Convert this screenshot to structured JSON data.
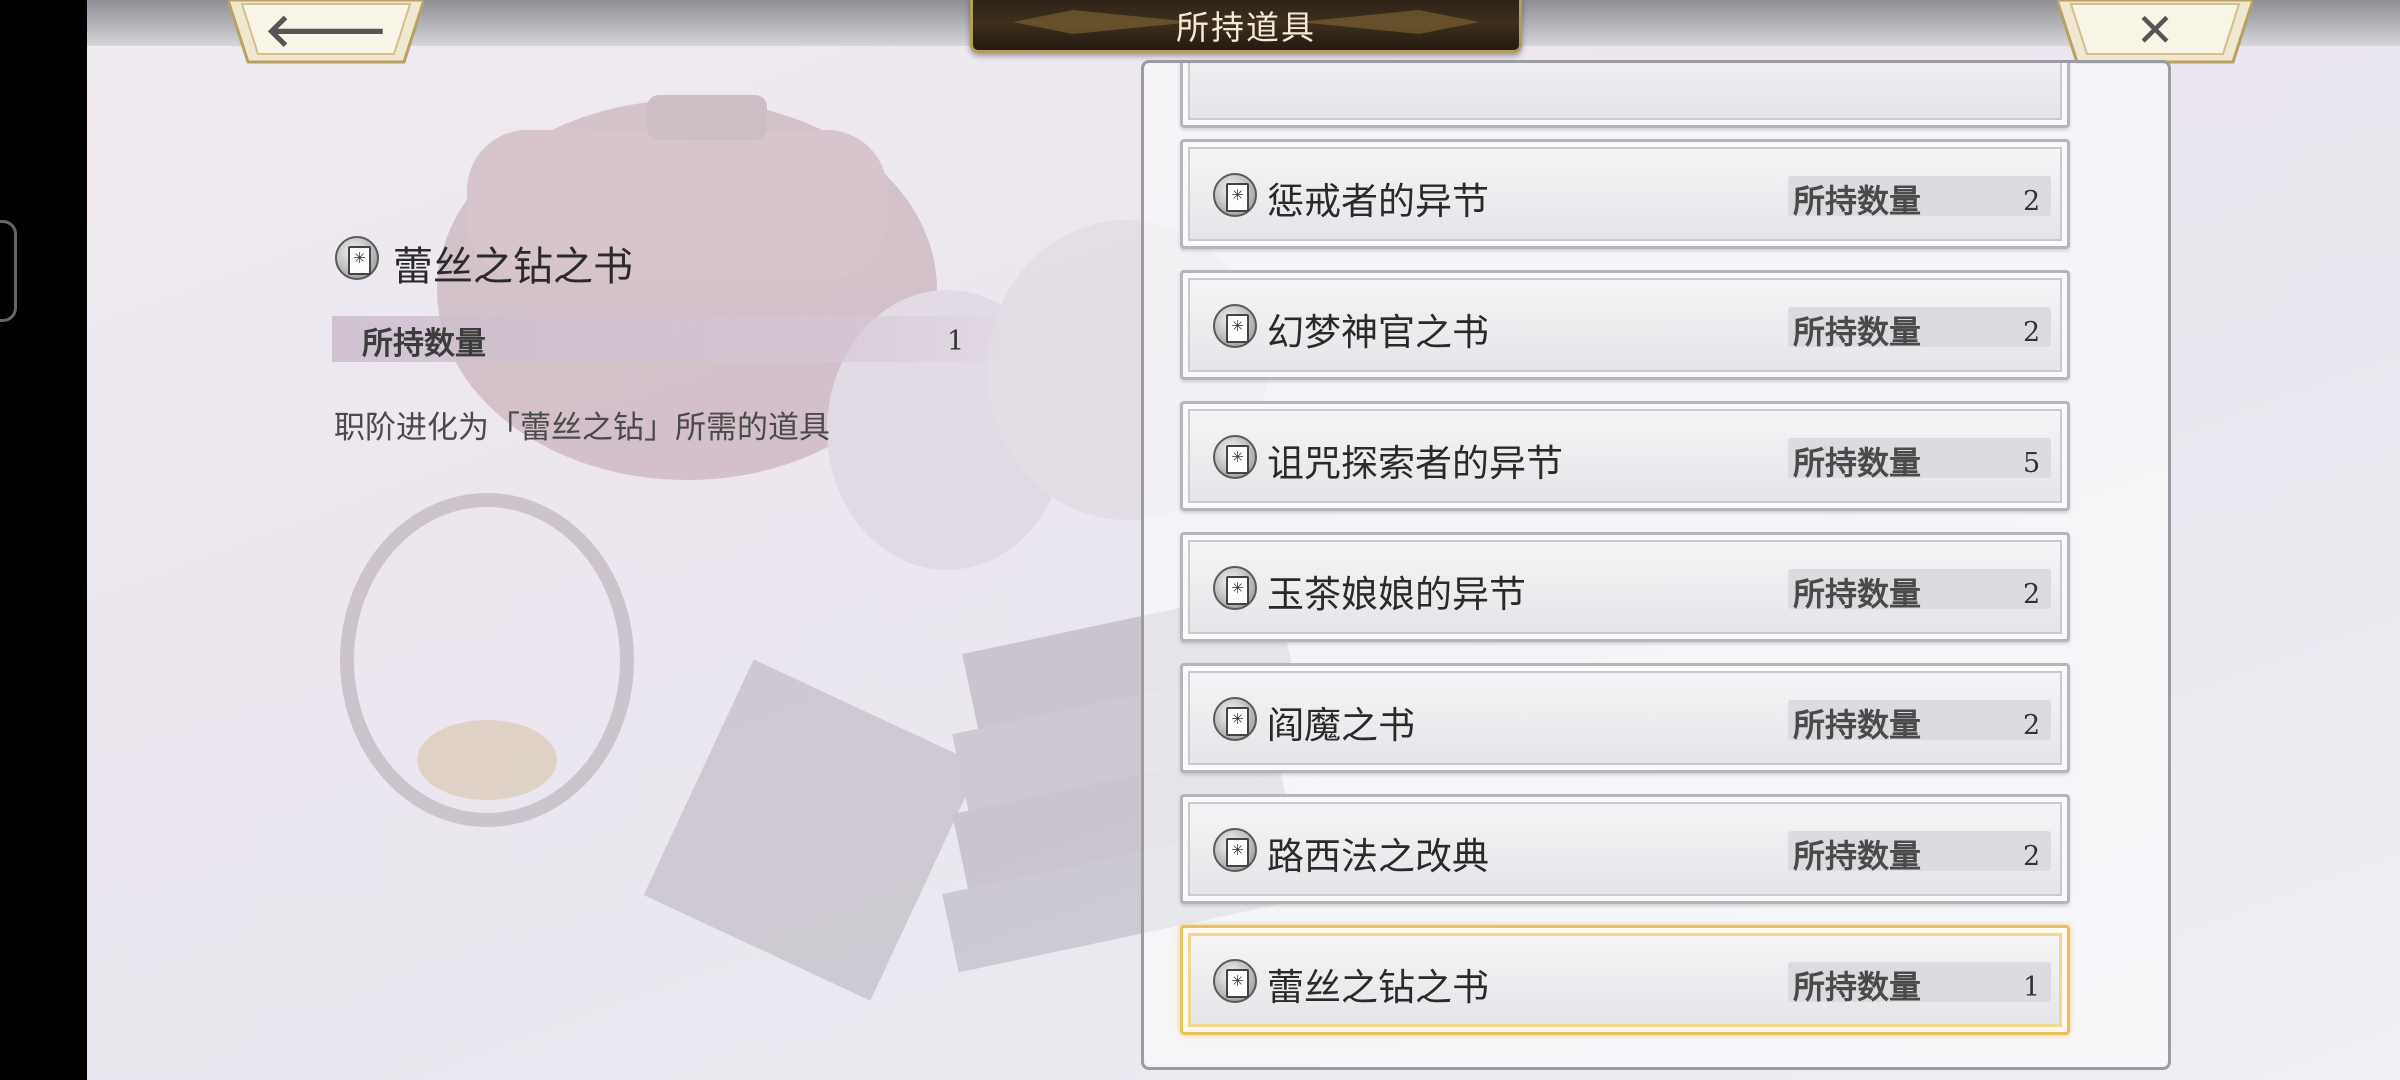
{
  "header": {
    "title": "所持道具"
  },
  "nav": {
    "back_icon": "left-arrow-icon",
    "close_icon": "close-icon"
  },
  "detail": {
    "title": "蕾丝之钻之书",
    "qty_label": "所持数量",
    "qty_value": "1",
    "description": "职阶进化为「蕾丝之钻」所需的道具"
  },
  "items": [
    {
      "name": "惩戒者的异节",
      "qty_label": "所持数量",
      "qty": "2"
    },
    {
      "name": "幻梦神官之书",
      "qty_label": "所持数量",
      "qty": "2"
    },
    {
      "name": "诅咒探索者的异节",
      "qty_label": "所持数量",
      "qty": "5"
    },
    {
      "name": "玉茶娘娘的异节",
      "qty_label": "所持数量",
      "qty": "2"
    },
    {
      "name": "阎魔之书",
      "qty_label": "所持数量",
      "qty": "2"
    },
    {
      "name": "路西法之改典",
      "qty_label": "所持数量",
      "qty": "2"
    },
    {
      "name": "蕾丝之钻之书",
      "qty_label": "所持数量",
      "qty": "1"
    }
  ],
  "selected_index": 6,
  "colors": {
    "selected_border": "#e9c25d",
    "title_plate": "#3f2f1c",
    "title_trim": "#b59b5f"
  }
}
